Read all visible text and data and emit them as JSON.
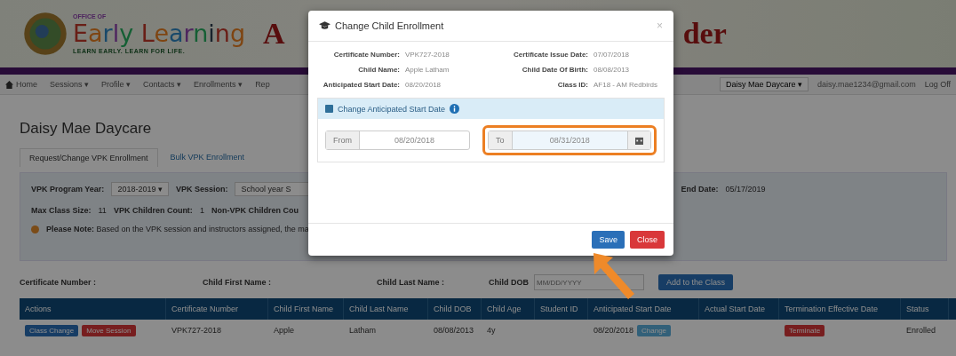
{
  "header": {
    "logo_top": "OFFICE OF",
    "logo_name": "Early Learning",
    "logo_tagline": "LEARN EARLY. LEARN FOR LIFE.",
    "title_left": "A",
    "title_right": "der"
  },
  "nav": {
    "items": [
      "Home",
      "Sessions ▾",
      "Profile ▾",
      "Contacts ▾",
      "Enrollments ▾",
      "Rep"
    ],
    "provider": "Daisy Mae Daycare",
    "provider_caret": "▾",
    "email": "daisy.mae1234@gmail.com",
    "logoff": "Log Off"
  },
  "page_title": "Daisy Mae Daycare",
  "tabs": [
    {
      "label": "Request/Change VPK Enrollment",
      "selected": true
    },
    {
      "label": "Bulk VPK Enrollment",
      "selected": false
    }
  ],
  "filters": {
    "program_year_label": "VPK Program Year:",
    "program_year": "2018-2019 ▾",
    "session_label": "VPK Session:",
    "session": "School year S",
    "end_date_label": "End Date:",
    "end_date": "05/17/2019",
    "max_size_label": "Max Class Size:",
    "max_size": "11",
    "vpk_count_label": "VPK Children Count:",
    "vpk_count": "1",
    "non_vpk_label": "Non-VPK Children Cou",
    "note_label": "Please Note:",
    "note": "Based on the VPK session and instructors assigned, the ma"
  },
  "search": {
    "cert_label": "Certificate Number :",
    "first_label": "Child First Name :",
    "last_label": "Child Last Name :",
    "dob_label": "Child DOB",
    "dob_placeholder": "MM/DD/YYYY",
    "add_button": "Add to the Class"
  },
  "table": {
    "columns": [
      "Actions",
      "Certificate Number",
      "Child First Name",
      "Child Last Name",
      "Child DOB",
      "Child Age",
      "Student ID",
      "Anticipated Start Date",
      "Actual Start Date",
      "Termination Effective Date",
      "Status"
    ],
    "rows": [
      {
        "actions": [
          {
            "label": "Class Change",
            "kind": "primary"
          },
          {
            "label": "Move Session",
            "kind": "danger"
          }
        ],
        "certificate": "VPK727-2018",
        "first": "Apple",
        "last": "Latham",
        "dob": "08/08/2013",
        "age": "4y",
        "start": "08/20/2018",
        "change": "Change",
        "terminate": "Terminate",
        "status": "Enrolled"
      }
    ]
  },
  "modal": {
    "title": "Change Child Enrollment",
    "close": "×",
    "fields": [
      {
        "label": "Certificate Number:",
        "value": "VPK727-2018"
      },
      {
        "label": "Certificate Issue Date:",
        "value": "07/07/2018"
      },
      {
        "label": "Child Name:",
        "value": "Apple Latham"
      },
      {
        "label": "Child Date Of Birth:",
        "value": "08/08/2013"
      },
      {
        "label": "Anticipated Start Date:",
        "value": "08/20/2018"
      },
      {
        "label": "Class ID:",
        "value": "AF18 - AM Redbirds"
      }
    ],
    "panel_title": "Change Anticipated Start Date",
    "from_label": "From",
    "from_value": "08/20/2018",
    "to_label": "To",
    "to_value": "08/31/2018",
    "buttons": [
      {
        "label": "Save",
        "kind": "primary"
      },
      {
        "label": "Close",
        "kind": "danger"
      }
    ]
  }
}
